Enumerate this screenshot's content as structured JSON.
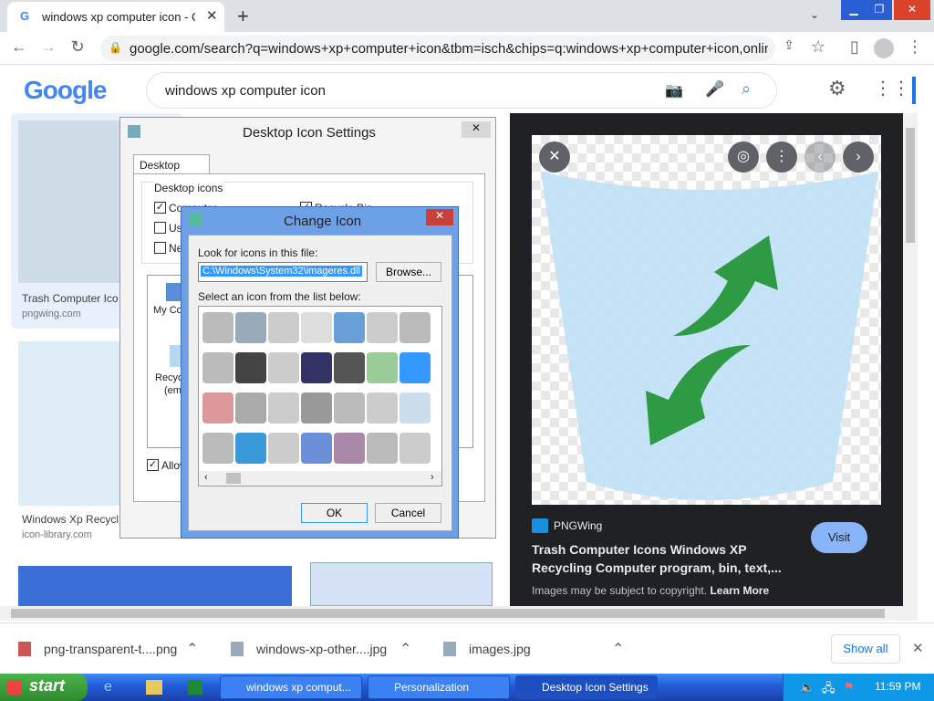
{
  "browser": {
    "tab_title": "windows xp computer icon - Go",
    "new_tab": "+",
    "url": "google.com/search?q=windows+xp+computer+icon&tbm=isch&chips=q:windows+xp+computer+icon,online_..."
  },
  "google": {
    "logo": "Google",
    "query": "windows xp computer icon"
  },
  "results": [
    {
      "title": "Trash Computer Ico",
      "source": "pngwing.com"
    },
    {
      "title": "Windows Xp Recycl",
      "source": "icon-library.com"
    }
  ],
  "preview": {
    "source": "PNGWing",
    "title": "Trash Computer Icons Windows XP Recycling Computer program, bin, text,...",
    "visit": "Visit",
    "copyright": "Images may be subject to copyright.",
    "learn_more": "Learn More"
  },
  "desktop_icon_settings": {
    "title": "Desktop Icon Settings",
    "tab": "Desktop Icons",
    "group": "Desktop icons",
    "checkboxes": [
      "Computer",
      "Recycle Bin",
      "Use",
      "Ne"
    ],
    "icon_labels": [
      "My Co",
      "Recyc",
      "(em"
    ],
    "allow": "Allow"
  },
  "change_icon": {
    "title": "Change Icon",
    "look_label": "Look for icons in this file:",
    "file_path": "C:\\Windows\\System32\\imageres.dll",
    "browse": "Browse...",
    "list_label": "Select an icon from the list below:",
    "ok": "OK",
    "cancel": "Cancel"
  },
  "downloads": {
    "items": [
      "png-transparent-t....png",
      "windows-xp-other....jpg",
      "images.jpg"
    ],
    "show_all": "Show all"
  },
  "taskbar": {
    "start": "start",
    "items": [
      "windows xp comput...",
      "Personalization",
      "Desktop Icon Settings"
    ],
    "clock": "11:59 PM"
  }
}
